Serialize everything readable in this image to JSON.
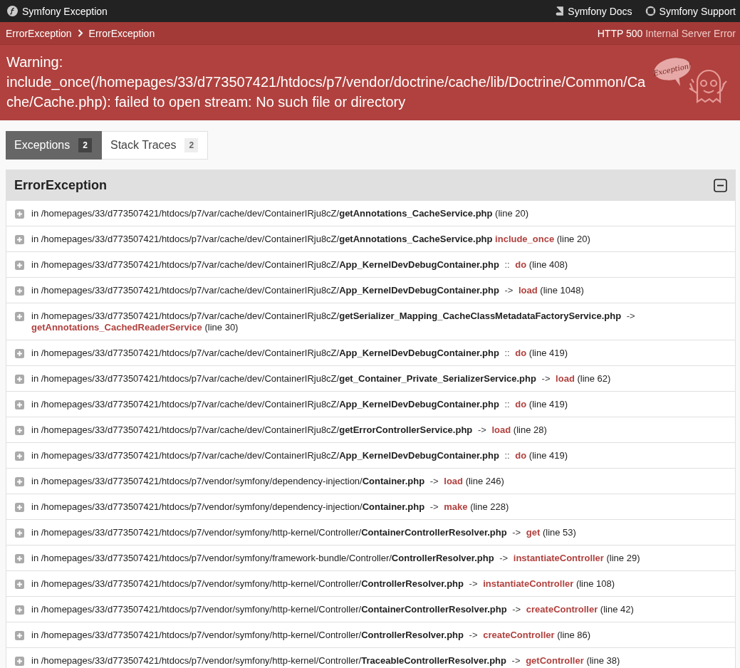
{
  "top_bar": {
    "title": "Symfony Exception",
    "links": [
      {
        "kind": "docs",
        "label": "Symfony Docs"
      },
      {
        "kind": "support",
        "label": "Symfony Support"
      }
    ]
  },
  "breadcrumb": {
    "items": [
      "ErrorException",
      "ErrorException"
    ],
    "status_code": "HTTP 500",
    "status_text": "Internal Server Error"
  },
  "message": "Warning: include_once(/homepages/33/d773507421/htdocs/p7/vendor/doctrine/cache/lib/Doctrine/Common/Cache/Cache.php): failed to open stream: No such file or directory",
  "mascot_bubble": "Exception!",
  "tabs": [
    {
      "label": "Exceptions",
      "count": "2",
      "selected": true
    },
    {
      "label": "Stack Traces",
      "count": "2",
      "selected": false
    }
  ],
  "panel": {
    "title": "ErrorException",
    "expanded": true,
    "traces": [
      {
        "path": "in /homepages/33/d773507421/htdocs/p7/var/cache/dev/ContainerIRju8cZ/",
        "file": "getAnnotations_CacheService.php",
        "line": "(line 20)",
        "expanded": false
      },
      {
        "path": "in /homepages/33/d773507421/htdocs/p7/var/cache/dev/ContainerIRju8cZ/",
        "file": "getAnnotations_CacheService.php",
        "function": "include_once",
        "line": "(line 20)",
        "expanded": false
      },
      {
        "path": "in /homepages/33/d773507421/htdocs/p7/var/cache/dev/ContainerIRju8cZ/",
        "file": "App_KernelDevDebugContainer.php",
        "separator": "::",
        "function": "do",
        "line": "(line 408)",
        "expanded": false
      },
      {
        "path": "in /homepages/33/d773507421/htdocs/p7/var/cache/dev/ContainerIRju8cZ/",
        "file": "App_KernelDevDebugContainer.php",
        "separator": "->",
        "function": "load",
        "line": "(line 1048)",
        "expanded": false
      },
      {
        "path": "in /homepages/33/d773507421/htdocs/p7/var/cache/dev/ContainerIRju8cZ/",
        "file": "getSerializer_Mapping_CacheClassMetadataFactoryService.php",
        "separator": "->",
        "function": "getAnnotations_CachedReaderService",
        "line": "(line 30)",
        "expanded": false
      },
      {
        "path": "in /homepages/33/d773507421/htdocs/p7/var/cache/dev/ContainerIRju8cZ/",
        "file": "App_KernelDevDebugContainer.php",
        "separator": "::",
        "function": "do",
        "line": "(line 419)",
        "expanded": false
      },
      {
        "path": "in /homepages/33/d773507421/htdocs/p7/var/cache/dev/ContainerIRju8cZ/",
        "file": "get_Container_Private_SerializerService.php",
        "separator": "->",
        "function": "load",
        "line": "(line 62)",
        "expanded": false
      },
      {
        "path": "in /homepages/33/d773507421/htdocs/p7/var/cache/dev/ContainerIRju8cZ/",
        "file": "App_KernelDevDebugContainer.php",
        "separator": "::",
        "function": "do",
        "line": "(line 419)",
        "expanded": false
      },
      {
        "path": "in /homepages/33/d773507421/htdocs/p7/var/cache/dev/ContainerIRju8cZ/",
        "file": "getErrorControllerService.php",
        "separator": "->",
        "function": "load",
        "line": "(line 28)",
        "expanded": false
      },
      {
        "path": "in /homepages/33/d773507421/htdocs/p7/var/cache/dev/ContainerIRju8cZ/",
        "file": "App_KernelDevDebugContainer.php",
        "separator": "::",
        "function": "do",
        "line": "(line 419)",
        "expanded": false
      },
      {
        "path": "in /homepages/33/d773507421/htdocs/p7/vendor/symfony/dependency-injection/",
        "file": "Container.php",
        "separator": "->",
        "function": "load",
        "line": "(line 246)",
        "expanded": false
      },
      {
        "path": "in /homepages/33/d773507421/htdocs/p7/vendor/symfony/dependency-injection/",
        "file": "Container.php",
        "separator": "->",
        "function": "make",
        "line": "(line 228)",
        "expanded": false
      },
      {
        "path": "in /homepages/33/d773507421/htdocs/p7/vendor/symfony/http-kernel/Controller/",
        "file": "ContainerControllerResolver.php",
        "separator": "->",
        "function": "get",
        "line": "(line 53)",
        "expanded": false
      },
      {
        "path": "in /homepages/33/d773507421/htdocs/p7/vendor/symfony/framework-bundle/Controller/",
        "file": "ControllerResolver.php",
        "separator": "->",
        "function": "instantiateController",
        "line": "(line 29)",
        "expanded": false
      },
      {
        "path": "in /homepages/33/d773507421/htdocs/p7/vendor/symfony/http-kernel/Controller/",
        "file": "ControllerResolver.php",
        "separator": "->",
        "function": "instantiateController",
        "line": "(line 108)",
        "expanded": false
      },
      {
        "path": "in /homepages/33/d773507421/htdocs/p7/vendor/symfony/http-kernel/Controller/",
        "file": "ContainerControllerResolver.php",
        "separator": "->",
        "function": "createController",
        "line": "(line 42)",
        "expanded": false
      },
      {
        "path": "in /homepages/33/d773507421/htdocs/p7/vendor/symfony/http-kernel/Controller/",
        "file": "ControllerResolver.php",
        "separator": "->",
        "function": "createController",
        "line": "(line 86)",
        "expanded": false
      },
      {
        "path": "in /homepages/33/d773507421/htdocs/p7/vendor/symfony/http-kernel/Controller/",
        "file": "TraceableControllerResolver.php",
        "separator": "->",
        "function": "getController",
        "line": "(line 38)",
        "expanded": false
      }
    ]
  }
}
